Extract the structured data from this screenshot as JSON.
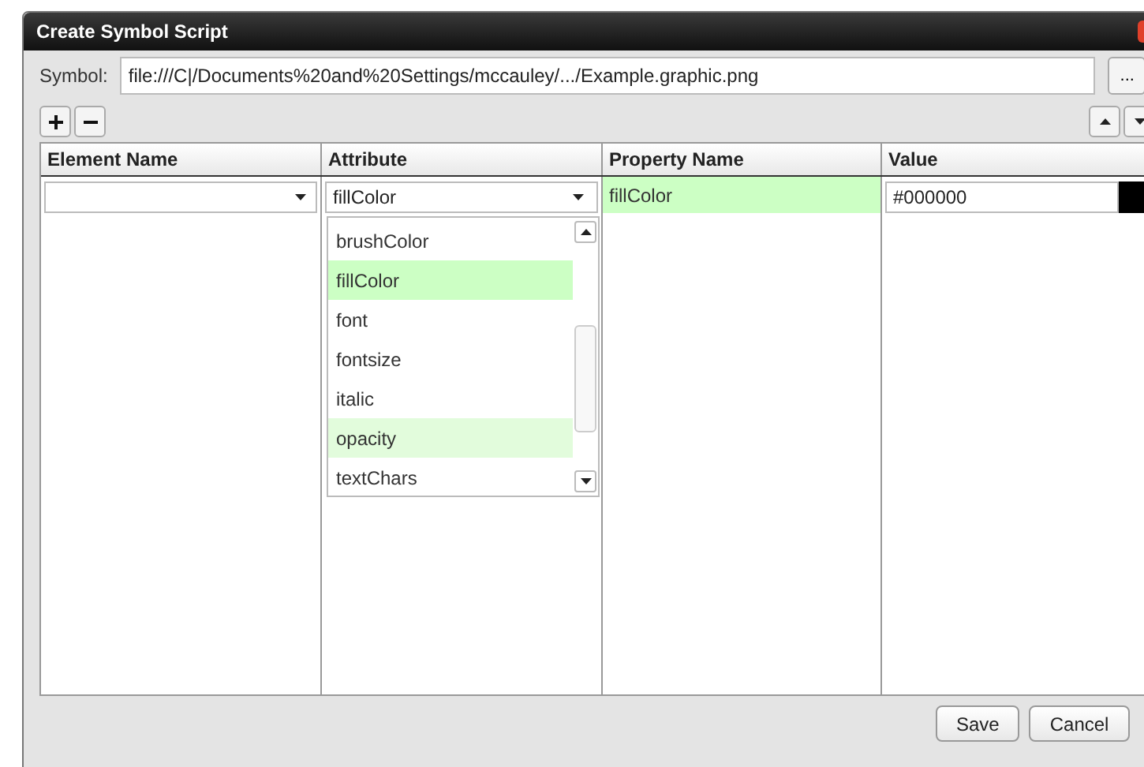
{
  "window": {
    "title": "Create Symbol Script"
  },
  "symbol": {
    "label": "Symbol:",
    "value": "file:///C|/Documents%20and%20Settings/mccauley/.../Example.graphic.png",
    "browse": "..."
  },
  "table": {
    "columns": [
      "Element Name",
      "Attribute",
      "Property Name",
      "Value"
    ],
    "row": {
      "attribute": "fillColor",
      "property_name": "fillColor",
      "value": "#000000"
    }
  },
  "attribute_dropdown": {
    "items": [
      {
        "label": "brushColor",
        "selected": false,
        "hovered": false
      },
      {
        "label": "fillColor",
        "selected": true,
        "hovered": false
      },
      {
        "label": "font",
        "selected": false,
        "hovered": false
      },
      {
        "label": "fontsize",
        "selected": false,
        "hovered": false
      },
      {
        "label": "italic",
        "selected": false,
        "hovered": false
      },
      {
        "label": "opacity",
        "selected": false,
        "hovered": true
      },
      {
        "label": "textChars",
        "selected": false,
        "hovered": false
      }
    ]
  },
  "buttons": [
    "Save",
    "Cancel"
  ]
}
